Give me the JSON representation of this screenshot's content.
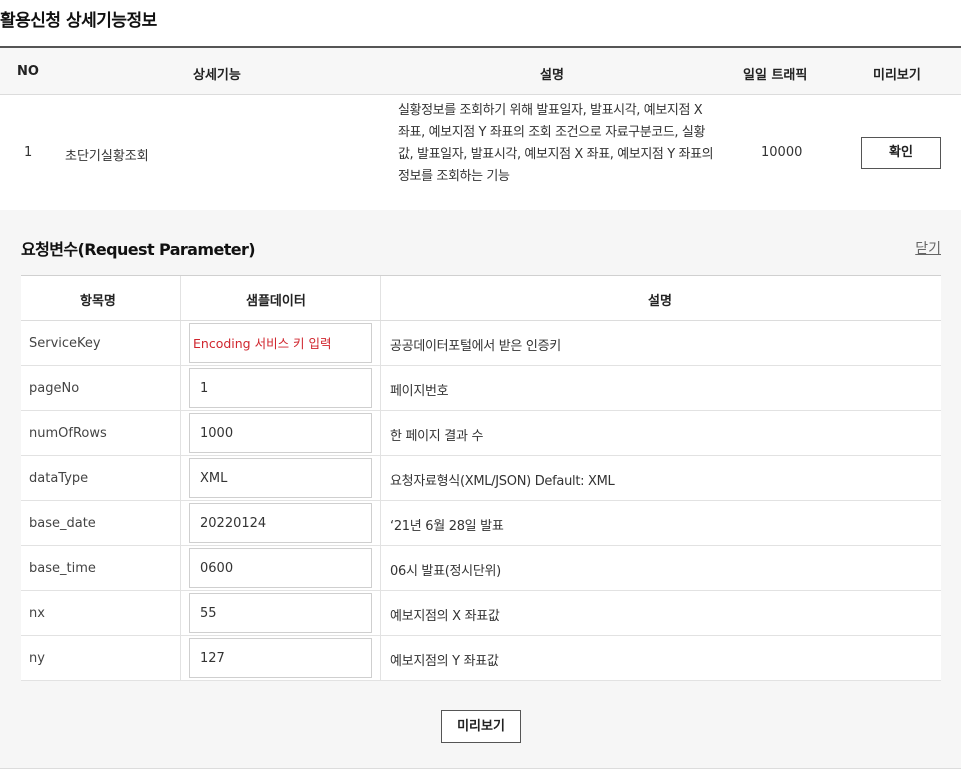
{
  "page": {
    "title": "활용신청 상세기능정보"
  },
  "main_table": {
    "headers": {
      "no": "NO",
      "feature": "상세기능",
      "description": "설명",
      "traffic": "일일 트래픽",
      "preview": "미리보기"
    },
    "rows": [
      {
        "no": "1",
        "feature": "초단기실황조회",
        "description": "실황정보를 조회하기 위해 발표일자, 발표시각, 예보지점 X 좌표, 예보지점 Y 좌표의 조회 조건으로 자료구분코드, 실황값, 발표일자, 발표시각, 예보지점 X 좌표, 예보지점 Y 좌표의 정보를 조회하는 기능",
        "traffic": "10000",
        "button_label": "확인"
      }
    ]
  },
  "request_panel": {
    "title": "요청변수(Request Parameter)",
    "close_label": "닫기",
    "headers": {
      "name": "항목명",
      "sample": "샘플데이터",
      "description": "설명"
    },
    "params": [
      {
        "name": "ServiceKey",
        "value": "",
        "placeholder": "Encoding 서비스 키 입력",
        "description": "공공데이터포털에서 받은 인증키"
      },
      {
        "name": "pageNo",
        "value": "1",
        "description": "페이지번호"
      },
      {
        "name": "numOfRows",
        "value": "1000",
        "description": "한 페이지 결과 수"
      },
      {
        "name": "dataType",
        "value": "XML",
        "description": "요청자료형식(XML/JSON) Default: XML"
      },
      {
        "name": "base_date",
        "value": "20220124",
        "description": "‘21년 6월 28일 발표"
      },
      {
        "name": "base_time",
        "value": "0600",
        "description": "06시 발표(정시단위)"
      },
      {
        "name": "nx",
        "value": "55",
        "description": "예보지점의 X 좌표값"
      },
      {
        "name": "ny",
        "value": "127",
        "description": "예보지점의 Y 좌표값"
      }
    ],
    "preview_button": "미리보기"
  },
  "colors": {
    "key_placeholder": "#d0262e",
    "panel_bg": "#f6f6f6",
    "header_bg": "#f7f7f7"
  }
}
